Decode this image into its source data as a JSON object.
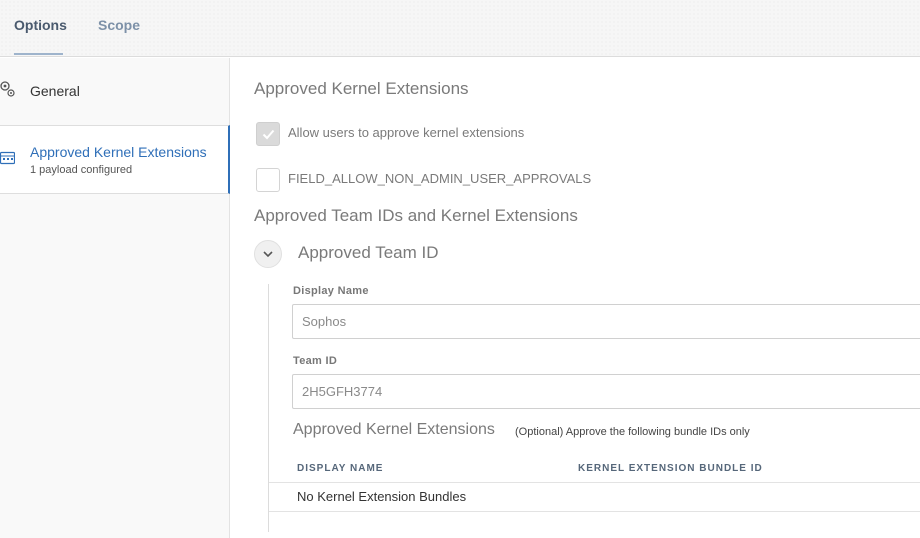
{
  "tabs": {
    "options": "Options",
    "scope": "Scope"
  },
  "sidebar": {
    "items": [
      {
        "label": "General",
        "icon": "gear-icon"
      },
      {
        "label": "Approved Kernel Extensions",
        "sub": "1 payload configured",
        "icon": "kernel-extension-icon",
        "active": true
      }
    ]
  },
  "main": {
    "title": "Approved Kernel Extensions",
    "allow_users_label": "Allow users to approve kernel extensions",
    "allow_users_checked": true,
    "non_admin_label": "FIELD_ALLOW_NON_ADMIN_USER_APPROVALS",
    "non_admin_checked": false,
    "team_section_title": "Approved Team IDs and Kernel Extensions",
    "team": {
      "title": "Approved Team ID",
      "display_name_label": "Display Name",
      "display_name_value": "Sophos",
      "team_id_label": "Team ID",
      "team_id_value": "2H5GFH3774",
      "ke_title": "Approved Kernel Extensions",
      "ke_note": "(Optional) Approve the following bundle IDs only",
      "table": {
        "columns": [
          "DISPLAY NAME",
          "KERNEL EXTENSION BUNDLE ID"
        ],
        "empty_text": "No Kernel Extension Bundles"
      }
    }
  },
  "colors": {
    "accent": "#2f6fb8",
    "tab_active": "#4a5a6e",
    "tab_inactive": "#7d91a8"
  }
}
